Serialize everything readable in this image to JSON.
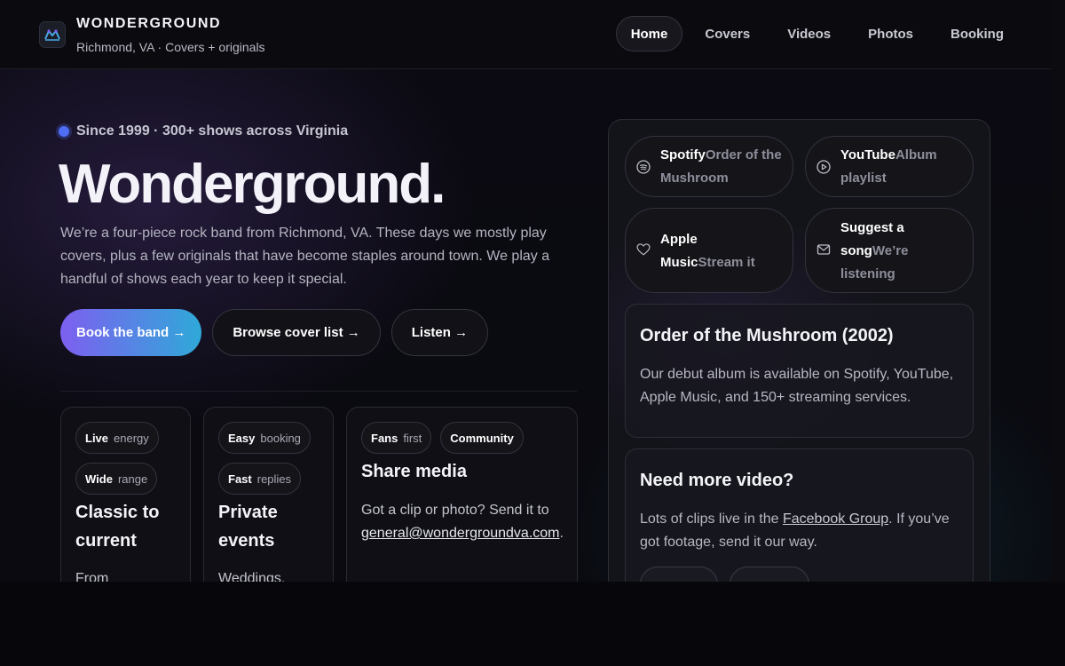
{
  "header": {
    "brand_name": "WONDERGROUND",
    "brand_sub": "Richmond, VA · Covers + originals",
    "logo_icon": "logo-icon",
    "nav": [
      {
        "label": "Home",
        "active": true
      },
      {
        "label": "Covers",
        "active": false
      },
      {
        "label": "Videos",
        "active": false
      },
      {
        "label": "Photos",
        "active": false
      },
      {
        "label": "Booking",
        "active": false
      }
    ]
  },
  "hero": {
    "eyebrow": "Since 1999 · 300+ shows across Virginia",
    "title": "Wonderground.",
    "description": "We’re a four-piece rock band from Richmond, VA. These days we mostly play covers, plus a few originals that have become staples around town. We play a handful of shows each year to keep it special.",
    "buttons": {
      "book": "Book the band →",
      "browse": "Browse cover list →",
      "listen": "Listen →"
    }
  },
  "features": [
    {
      "tags": [
        {
          "strong": "Live",
          "soft": "energy"
        },
        {
          "strong": "Wide",
          "soft": "range"
        }
      ],
      "title": "Classic to current",
      "body": "From"
    },
    {
      "tags": [
        {
          "strong": "Easy",
          "soft": "booking"
        },
        {
          "strong": "Fast",
          "soft": "replies"
        }
      ],
      "title": "Private events",
      "body": "Weddings,"
    },
    {
      "tags": [
        {
          "strong": "Fans",
          "soft": "first"
        },
        {
          "strong": "Community",
          "soft": ""
        }
      ],
      "title": "Share media",
      "body_prefix": "Got a clip or photo? Send it to",
      "email": "general@wondergroundva.com",
      "body_suffix": "."
    }
  ],
  "panel": {
    "links": [
      {
        "strong": "Spotify",
        "soft": "Order of the Mushroom",
        "icon": "spotify-icon"
      },
      {
        "strong": "YouTube",
        "soft": "Album playlist",
        "icon": "play-circle-icon"
      },
      {
        "strong": "Apple Music",
        "soft": "Stream it",
        "icon": "heart-icon"
      },
      {
        "strong": "Suggest a song",
        "soft": "We’re listening",
        "icon": "mail-icon"
      }
    ],
    "album_card": {
      "title": "Order of the Mushroom (2002)",
      "body": "Our debut album is available on Spotify, YouTube, Apple Music, and 150+ streaming services."
    },
    "video_card": {
      "title": "Need more video?",
      "body_prefix": "Lots of clips live in the",
      "link": "Facebook Group",
      "body_suffix": ". If you’ve got footage, send it our way."
    }
  },
  "colors": {
    "accent_gradient_start": "#7d5ff0",
    "accent_gradient_end": "#2fa9d8",
    "dot": "#4f6df5",
    "background": "#0a0a10"
  }
}
